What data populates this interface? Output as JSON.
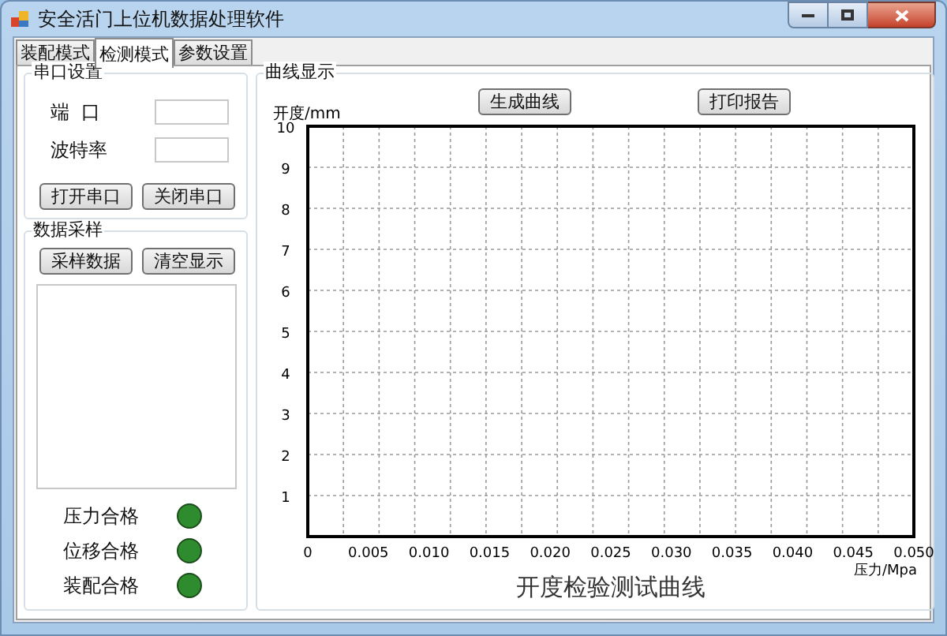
{
  "window": {
    "title": "安全活门上位机数据处理软件"
  },
  "tabs": [
    {
      "label": "装配模式",
      "selected": false
    },
    {
      "label": "检测模式",
      "selected": true
    },
    {
      "label": "参数设置",
      "selected": false
    }
  ],
  "serial_group": {
    "title": "串口设置",
    "fields": [
      {
        "label": "端  口"
      },
      {
        "label": "波特率"
      }
    ],
    "buttons": [
      "打开串口",
      "关闭串口"
    ]
  },
  "sampling_group": {
    "title": "数据采样",
    "buttons": [
      "采样数据",
      "清空显示"
    ],
    "indicators": [
      {
        "label": "压力合格",
        "color": "#2e8b2e"
      },
      {
        "label": "位移合格",
        "color": "#2e8b2e"
      },
      {
        "label": "装配合格",
        "color": "#2e8b2e"
      }
    ]
  },
  "curve_group": {
    "title": "曲线显示",
    "buttons": [
      "生成曲线",
      "打印报告"
    ],
    "chart_data": {
      "type": "line",
      "title": "开度检验测试曲线",
      "xlabel": "压力/Mpa",
      "ylabel": "开度/mm",
      "xlim": [
        0,
        0.05
      ],
      "ylim": [
        0,
        10
      ],
      "grid": true,
      "xticks": [
        {
          "value": 0,
          "label": "0"
        },
        {
          "value": 0.005,
          "label": "0.005"
        },
        {
          "value": 0.01,
          "label": "0.010"
        },
        {
          "value": 0.015,
          "label": "0.015"
        },
        {
          "value": 0.02,
          "label": "0.020"
        },
        {
          "value": 0.025,
          "label": "0.025"
        },
        {
          "value": 0.03,
          "label": "0.030"
        },
        {
          "value": 0.035,
          "label": "0.035"
        },
        {
          "value": 0.04,
          "label": "0.040"
        },
        {
          "value": 0.045,
          "label": "0.045"
        },
        {
          "value": 0.05,
          "label": "0.050"
        }
      ],
      "yticks": [
        {
          "value": 1,
          "label": "1"
        },
        {
          "value": 2,
          "label": "2"
        },
        {
          "value": 3,
          "label": "3"
        },
        {
          "value": 4,
          "label": "4"
        },
        {
          "value": 5,
          "label": "5"
        },
        {
          "value": 6,
          "label": "6"
        },
        {
          "value": 7,
          "label": "7"
        },
        {
          "value": 8,
          "label": "8"
        },
        {
          "value": 9,
          "label": "9"
        },
        {
          "value": 10,
          "label": "10"
        }
      ]
    }
  }
}
